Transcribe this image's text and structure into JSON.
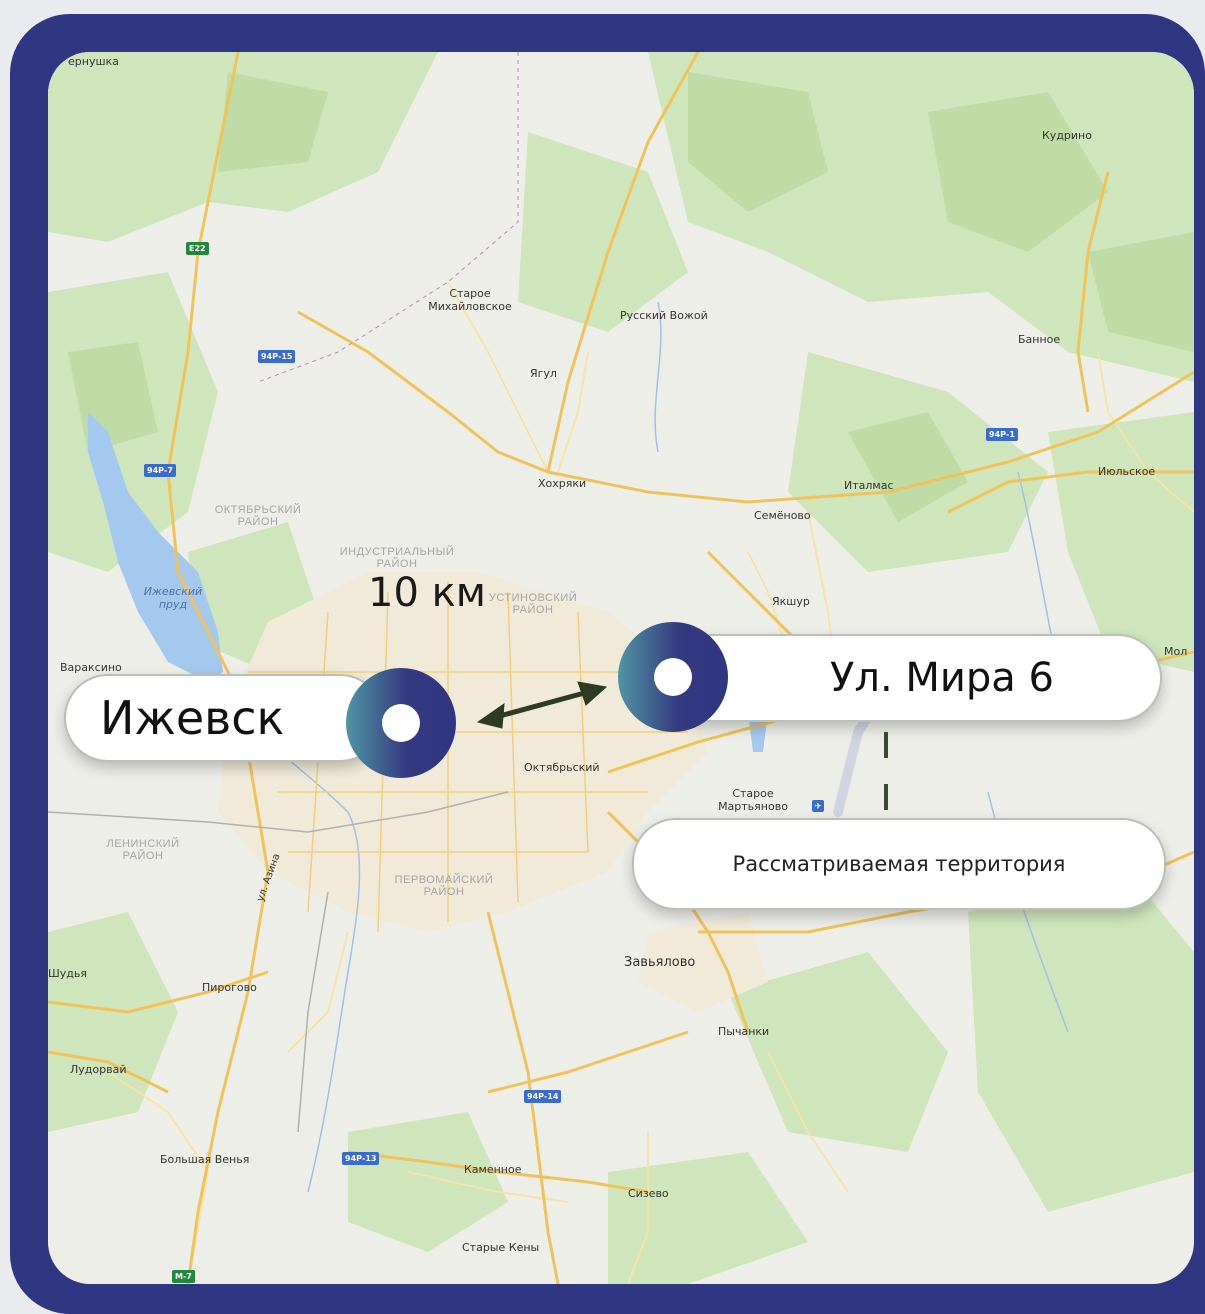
{
  "markers": {
    "city": {
      "label": "Ижевск"
    },
    "site": {
      "label": "Ул. Мира 6"
    },
    "territory": {
      "label": "Рассматриваемая территория"
    }
  },
  "distance": {
    "label": "10 км"
  },
  "places": {
    "chernushka": "ернушка",
    "kudrino": "Кудрино",
    "staroe_mikh_1": "Старое",
    "staroe_mikh_2": "Михайловское",
    "russkiy_vozhoy": "Русский Вожой",
    "bannoe": "Банное",
    "yagul": "Ягул",
    "hohryaki": "Хохряки",
    "italmas": "Италмас",
    "iyulskoe": "Июльское",
    "semenovo": "Семёново",
    "yakshur": "Якшур",
    "varaksino": "Вараксино",
    "mol": "Мол",
    "oktyabrskiy": "Октябрьский",
    "staroe_mart_1": "Старое",
    "staroe_mart_2": "Мартьяново",
    "zavyalovo": "Завьялово",
    "pychanki": "Пычанки",
    "pirogovo": "Пирогово",
    "shudya": "Шудья",
    "ludorvay": "Лудорвай",
    "bolshaya_venya": "Большая Венья",
    "kamennoe": "Каменное",
    "sizevo": "Сизево",
    "starye_keny": "Старые Кены",
    "ul_azina": "ул. Азина"
  },
  "districts": {
    "oktyabrsky_1": "ОКТЯБРЬСКИЙ",
    "oktyabrsky_2": "РАЙОН",
    "industrialny_1": "ИНДУСТРИАЛЬНЫЙ",
    "industrialny_2": "РАЙОН",
    "ustinovsky_1": "УСТИНОВСКИЙ",
    "ustinovsky_2": "РАЙОН",
    "leninsky_1": "ЛЕНИНСКИЙ",
    "leninsky_2": "РАЙОН",
    "pervomaysky_1": "ПЕРВОМАЙСКИЙ",
    "pervomaysky_2": "РАЙОН"
  },
  "water": {
    "pond_1": "Ижевский",
    "pond_2": "пруд"
  },
  "road_shields": {
    "e22": "E22",
    "r94_15": "94Р-15",
    "r94_7": "94Р-7",
    "r94_1": "94Р-1",
    "r94_14": "94Р-14",
    "r94_13": "94Р-13",
    "m7": "М-7"
  },
  "icons": {
    "airport": "airport-icon"
  },
  "colors": {
    "frame": "#2f3682",
    "marker_start": "#4f95a3",
    "marker_end": "#2f3682",
    "arrow": "#2d3b22",
    "road": "#f0c35a",
    "forest": "#cde6b8",
    "water": "#a3c6ef"
  }
}
